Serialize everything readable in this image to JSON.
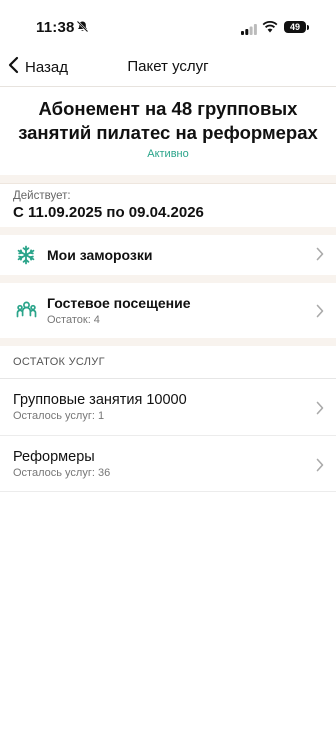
{
  "status_bar": {
    "time": "11:38",
    "battery": "49"
  },
  "nav": {
    "back_label": "Назад",
    "title": "Пакет услуг"
  },
  "header": {
    "title": "Абонемент на 48 групповых занятий пилатес на реформерах",
    "status": "Активно",
    "status_color": "#2aa48a"
  },
  "validity": {
    "label": "Действует:",
    "value": "С 11.09.2025 по 09.04.2026"
  },
  "freezes": {
    "label": "Мои заморозки",
    "icon": "snowflake-icon"
  },
  "guest": {
    "label": "Гостевое посещение",
    "sub": "Остаток: 4",
    "icon": "guests-icon"
  },
  "remaining": {
    "section_title": "ОСТАТОК УСЛУГ",
    "items": [
      {
        "title": "Групповые занятия 10000",
        "sub": "Осталось услуг: 1"
      },
      {
        "title": "Реформеры",
        "sub": "Осталось услуг: 36"
      }
    ]
  }
}
